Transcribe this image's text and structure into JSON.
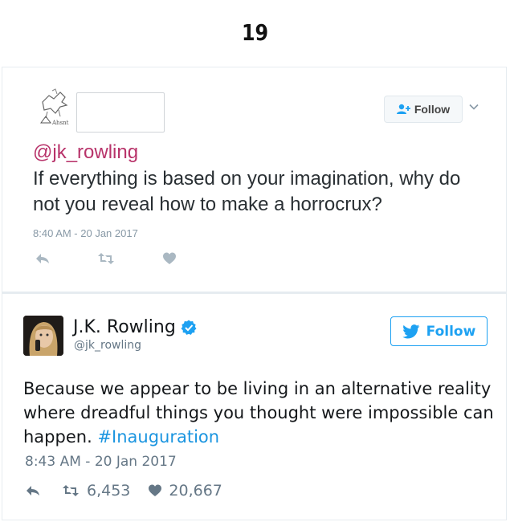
{
  "page": {
    "number": "19"
  },
  "tweet1": {
    "handle": "@jk_rowling",
    "text": "If everything is based on your imagination, why do not you reveal how to make a horrocrux?",
    "timestamp": "8:40 AM - 20 Jan 2017",
    "follow_label": "Follow",
    "icons": {
      "follow": "add-user-icon",
      "menu": "chevron-down-icon",
      "reply": "reply-icon",
      "retweet": "retweet-icon",
      "like": "heart-icon"
    }
  },
  "tweet2": {
    "name": "J.K. Rowling",
    "handle": "@jk_rowling",
    "text_main": "Because we appear to be living in an alternative reality where dreadful things you thought were impossible can happen.",
    "hashtag": "#Inauguration",
    "timestamp": "8:43 AM - 20 Jan 2017",
    "retweets": "6,453",
    "likes": "20,667",
    "follow_label": "Follow",
    "icons": {
      "verified": "verified-badge-icon",
      "follow": "twitter-bird-icon",
      "reply": "reply-icon",
      "retweet": "retweet-icon",
      "like": "heart-icon"
    }
  },
  "colors": {
    "handle_pink": "#b8336a",
    "twitter_blue": "#1da1f2",
    "hashtag_blue": "#1b95e0",
    "muted_gray": "#8899a6",
    "border": "#e6ecf0"
  }
}
